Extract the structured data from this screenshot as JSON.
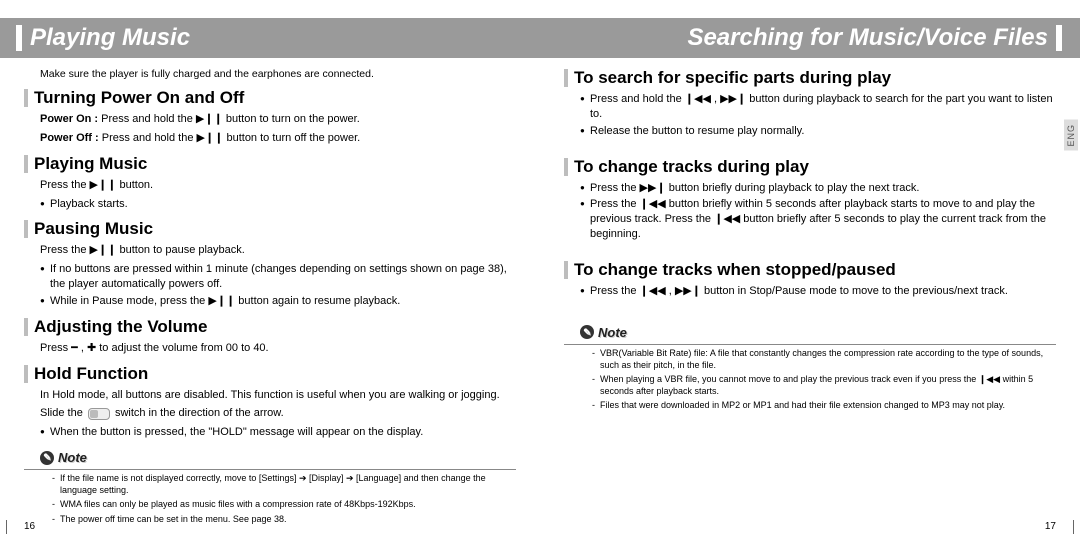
{
  "left": {
    "title": "Playing Music",
    "intro": "Make sure the player is fully charged and the earphones are connected.",
    "s1": {
      "h": "Turning Power On and Off",
      "on_label": "Power On :",
      "on_text": "Press and hold the ▶❙❙ button to turn on the power.",
      "off_label": "Power Off :",
      "off_text": "Press and hold the ▶❙❙ button to turn off the power."
    },
    "s2": {
      "h": "Playing Music",
      "line": "Press the ▶❙❙ button.",
      "b1": "Playback starts."
    },
    "s3": {
      "h": "Pausing Music",
      "line": "Press the ▶❙❙ button to pause playback.",
      "b1": "If no buttons are pressed within 1 minute (changes depending on settings shown on page 38), the player automatically powers off.",
      "b2": "While in Pause mode, press the ▶❙❙ button again to resume playback."
    },
    "s4": {
      "h": "Adjusting the Volume",
      "line": "Press ━ , ✚ to adjust the volume from 00 to 40."
    },
    "s5": {
      "h": "Hold Function",
      "line1": "In Hold mode, all buttons are disabled. This function is useful when you are walking or jogging.",
      "line2a": "Slide the",
      "line2b": "switch in the direction of the arrow.",
      "b1": "When the button is pressed, the \"HOLD\" message will appear on the display."
    },
    "note": {
      "h": "Note",
      "n1": "If the file name is not displayed correctly, move to [Settings] ➔ [Display] ➔ [Language] and then change the language setting.",
      "n2": "WMA files can only be played as music files with a compression rate of 48Kbps-192Kbps.",
      "n3": "The power off time can be set in the menu. See page 38."
    },
    "pagenum": "16"
  },
  "right": {
    "title": "Searching for Music/Voice Files",
    "s1": {
      "h": "To search for specific parts during play",
      "b1": "Press and hold the ❙◀◀ , ▶▶❙ button during playback to search for the part you want to listen to.",
      "b2": "Release the button to resume play normally."
    },
    "s2": {
      "h": "To change tracks during play",
      "b1": "Press the ▶▶❙ button briefly during playback to play the next track.",
      "b2": "Press the ❙◀◀ button briefly within 5 seconds after playback starts to move to and play the previous track. Press the ❙◀◀ button briefly after 5 seconds to play the current track from the beginning."
    },
    "s3": {
      "h": "To change tracks when stopped/paused",
      "b1": "Press the ❙◀◀ , ▶▶❙ button in Stop/Pause mode to move to the previous/next track."
    },
    "note": {
      "h": "Note",
      "n1": "VBR(Variable Bit Rate) file: A file that constantly changes the compression rate according to the type of sounds, such as their pitch, in the file.",
      "n2": "When playing a VBR file, you cannot move to and play the previous track even if you press the ❙◀◀ within 5 seconds after playback starts.",
      "n3": "Files that were downloaded in MP2 or MP1 and had their file extension changed to MP3 may not play."
    },
    "pagenum": "17",
    "lang_tab": "ENG"
  }
}
